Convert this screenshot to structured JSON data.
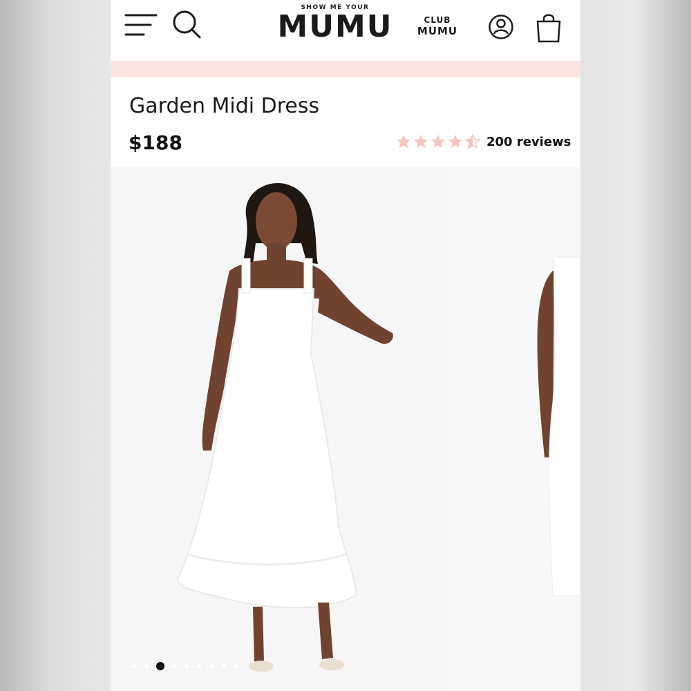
{
  "header": {
    "logo_top": "SHOW ME YOUR",
    "logo_main": "MUMU",
    "club_top": "CLUB",
    "club_main": "MUMU",
    "icons": [
      "menu-icon",
      "search-icon",
      "account-icon",
      "shopping-bag-icon"
    ]
  },
  "product": {
    "title": "Garden Midi Dress",
    "price": "$188",
    "rating": 4.5,
    "rating_max": 5,
    "reviews_label": "200 reviews"
  },
  "gallery": {
    "slide_count": 9,
    "active_slide_index": 2
  },
  "colors": {
    "promo_bar": "#fbe5e2",
    "star": "#f4c6c0",
    "text": "#111111"
  }
}
